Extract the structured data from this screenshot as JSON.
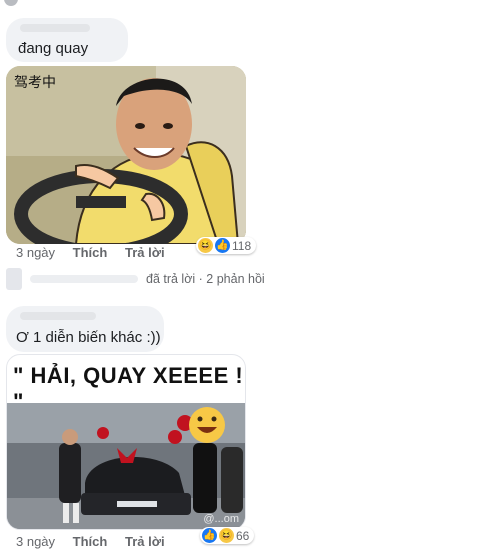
{
  "comment1": {
    "text": "đang quay"
  },
  "meme1": {
    "label": "驾考中"
  },
  "actions1": {
    "time": "3 ngày",
    "like": "Thích",
    "reply": "Trả lời",
    "reactions_count": "118"
  },
  "replies_summary": {
    "text": "đã trả lời · 2 phản hồi"
  },
  "comment2": {
    "text": "Ơ 1 diễn biến khác :))"
  },
  "meme2": {
    "headline": "\" HẢI, QUAY XEEEE ! \"",
    "watermark": "@...om"
  },
  "actions2": {
    "time": "3 ngày",
    "like": "Thích",
    "reply": "Trả lời",
    "reactions_count": "66"
  },
  "colors": {
    "bubble": "#f0f2f5",
    "meta_text": "#65676b",
    "like_blue": "#1877f2",
    "haha_yellow": "#f7c846"
  },
  "icons": [
    "haha-emoji-icon",
    "like-thumb-icon"
  ]
}
